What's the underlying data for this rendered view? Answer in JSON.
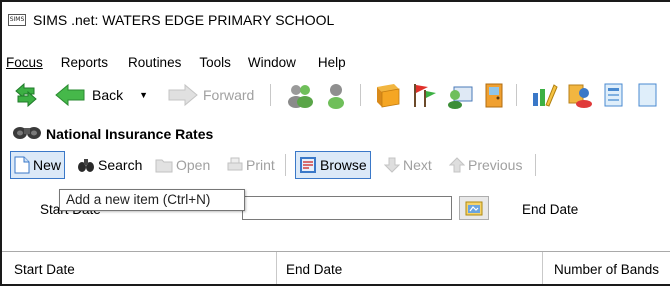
{
  "window": {
    "app_icon_text": "SIMS",
    "title": "SIMS .net: WATERS EDGE PRIMARY SCHOOL"
  },
  "menu": {
    "focus": "Focus",
    "reports": "Reports",
    "routines": "Routines",
    "tools": "Tools",
    "window": "Window",
    "help": "Help"
  },
  "toolbar": {
    "back_label": "Back",
    "forward_label": "Forward"
  },
  "section": {
    "title": "National Insurance Rates"
  },
  "actions": {
    "new": "New",
    "search": "Search",
    "open": "Open",
    "print": "Print",
    "browse": "Browse",
    "next": "Next",
    "previous": "Previous"
  },
  "tooltip": {
    "text": "Add a new item (Ctrl+N)"
  },
  "filter": {
    "start_date_label": "Start Date",
    "start_date_value": "",
    "end_date_label": "End Date"
  },
  "grid": {
    "columns": [
      "Start Date",
      "End Date",
      "Number of Bands"
    ]
  },
  "colors": {
    "accent_blue": "#3a78c8",
    "disabled_text": "#a0a0a0",
    "green_arrow": "#3cb043"
  }
}
